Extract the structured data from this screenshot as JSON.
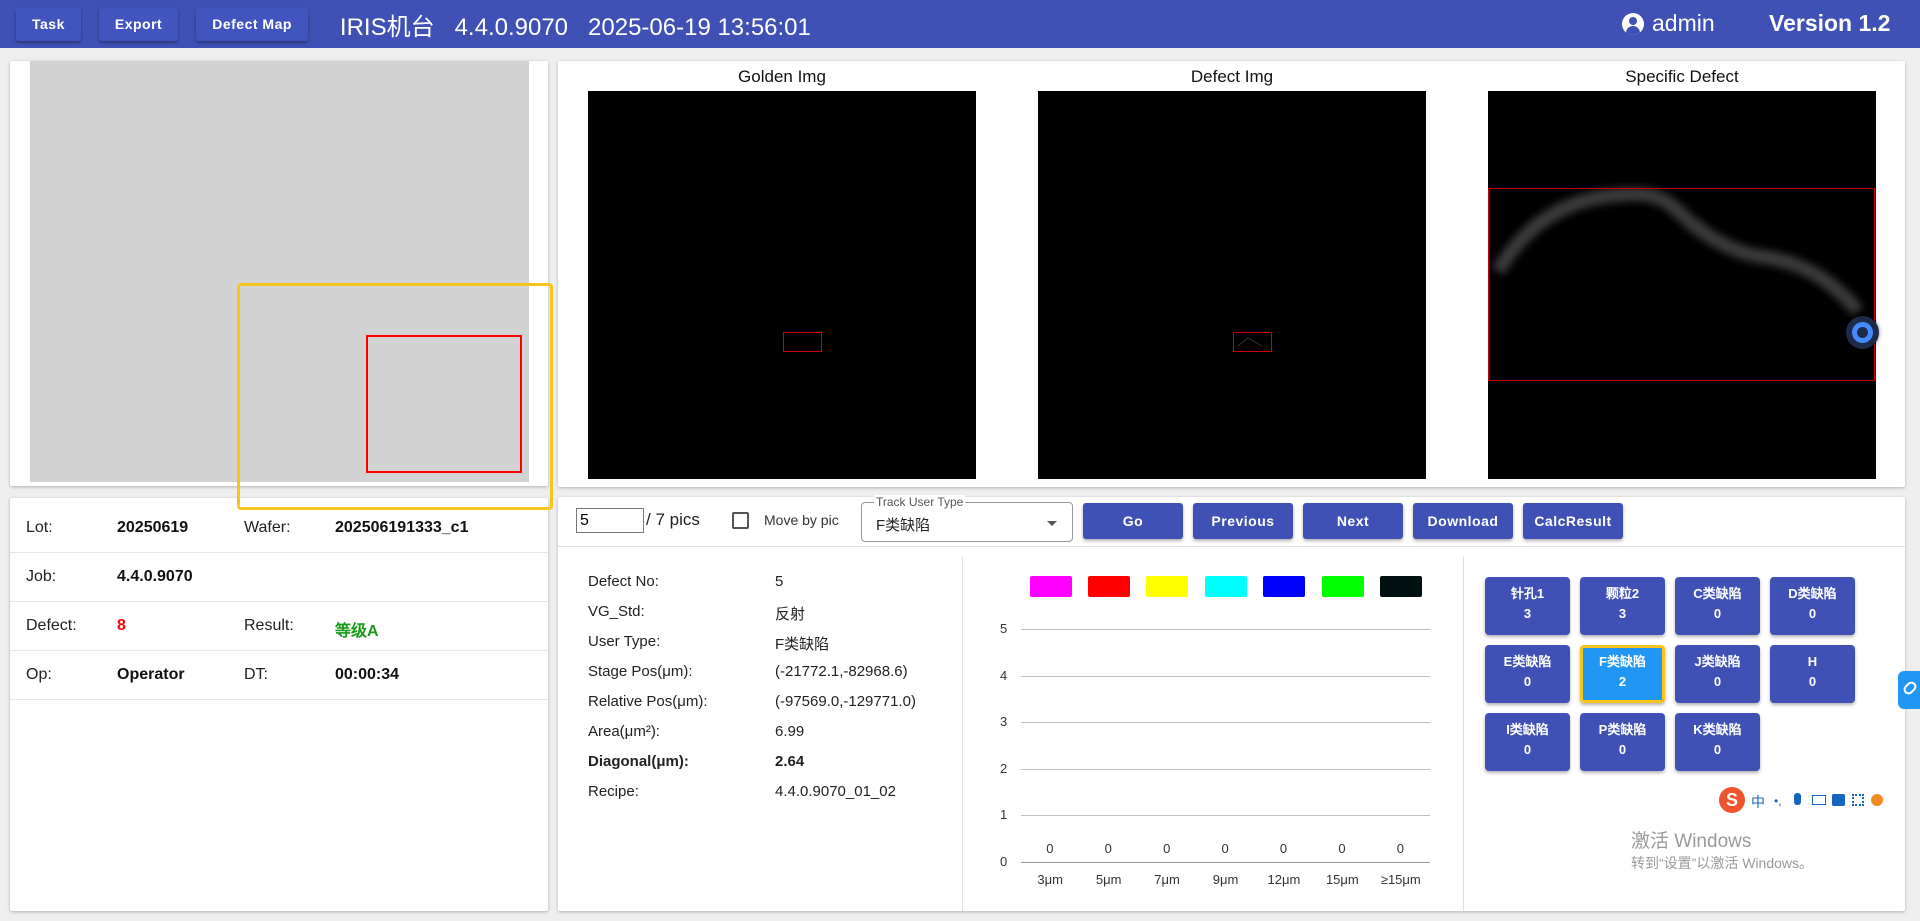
{
  "toolbar": {
    "task": "Task",
    "export": "Export",
    "defect_map": "Defect Map"
  },
  "header": {
    "title": "IRIS机台   4.4.0.9070   2025-06-19 13:56:01",
    "user": "admin",
    "version": "Version 1.2"
  },
  "info": {
    "lot_label": "Lot:",
    "lot": "20250619",
    "wafer_label": "Wafer:",
    "wafer": "202506191333_c1",
    "job_label": "Job:",
    "job": "4.4.0.9070",
    "defect_label": "Defect:",
    "defect": "8",
    "result_label": "Result:",
    "result": "等级A",
    "op_label": "Op:",
    "op": "Operator",
    "dt_label": "DT:",
    "dt": "00:00:34"
  },
  "images": {
    "golden": "Golden Img",
    "defect": "Defect Img",
    "specific": "Specific Defect"
  },
  "controls": {
    "page_value": "5",
    "page_total": "/ 7 pics",
    "move_by_pic": "Move by pic",
    "track_label": "Track User Type",
    "track_value": "F类缺陷",
    "go": "Go",
    "previous": "Previous",
    "next": "Next",
    "download": "Download",
    "calc": "CalcResult"
  },
  "details": [
    {
      "label": "Defect No:",
      "value": "5",
      "bold": false
    },
    {
      "label": "VG_Std:",
      "value": "反射",
      "bold": false
    },
    {
      "label": "User Type:",
      "value": "F类缺陷",
      "bold": false
    },
    {
      "label": "Stage Pos(μm):",
      "value": "(-21772.1,-82968.6)",
      "bold": false
    },
    {
      "label": "Relative Pos(μm):",
      "value": "(-97569.0,-129771.0)",
      "bold": false
    },
    {
      "label": "Area(μm²):",
      "value": "6.99",
      "bold": false
    },
    {
      "label": "Diagonal(μm):",
      "value": "2.64",
      "bold": true
    },
    {
      "label": "Recipe:",
      "value": "4.4.0.9070_01_02",
      "bold": false
    }
  ],
  "chart_data": {
    "type": "bar",
    "categories": [
      "3μm",
      "5μm",
      "7μm",
      "9μm",
      "12μm",
      "15μm",
      "≥15μm"
    ],
    "values": [
      0,
      0,
      0,
      0,
      0,
      0,
      0
    ],
    "legend_colors": [
      "#ff00ff",
      "#ff0000",
      "#ffff00",
      "#00ffff",
      "#0000ff",
      "#00ff00",
      "#001010"
    ],
    "ylim": [
      0,
      5
    ],
    "yticks": [
      0,
      1,
      2,
      3,
      4,
      5
    ],
    "grid": true
  },
  "categories": [
    {
      "name": "针孔1",
      "count": "3",
      "selected": false
    },
    {
      "name": "颗粒2",
      "count": "3",
      "selected": false
    },
    {
      "name": "C类缺陷",
      "count": "0",
      "selected": false
    },
    {
      "name": "D类缺陷",
      "count": "0",
      "selected": false
    },
    {
      "name": "E类缺陷",
      "count": "0",
      "selected": false
    },
    {
      "name": "F类缺陷",
      "count": "2",
      "selected": true
    },
    {
      "name": "J类缺陷",
      "count": "0",
      "selected": false
    },
    {
      "name": "H",
      "count": "0",
      "selected": false
    },
    {
      "name": "I类缺陷",
      "count": "0",
      "selected": false
    },
    {
      "name": "P类缺陷",
      "count": "0",
      "selected": false
    },
    {
      "name": "K类缺陷",
      "count": "0",
      "selected": false
    }
  ],
  "watermark": {
    "line1": "激活 Windows",
    "line2": "转到“设置”以激活 Windows。"
  },
  "ime": {
    "mode": "中"
  }
}
